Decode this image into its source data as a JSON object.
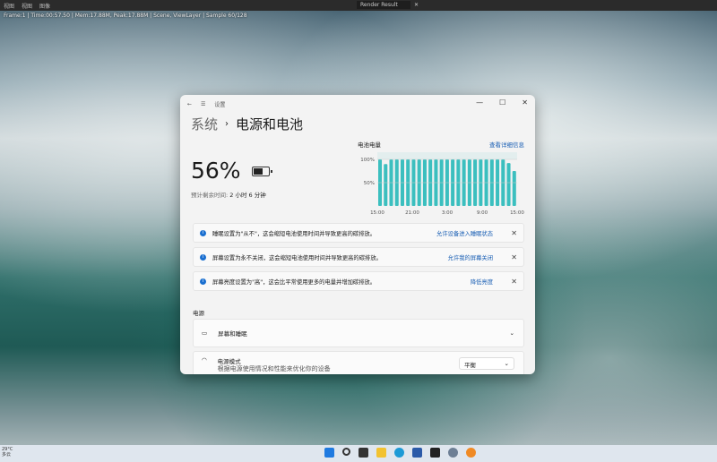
{
  "blender": {
    "menu": [
      "视图",
      "视图",
      "图像"
    ],
    "status": "Frame:1 | Time:00:57.50 | Mem:17.88M, Peak:17.88M | Scene, ViewLayer | Sample 60/128",
    "image_name": "Render Result"
  },
  "settings": {
    "window_title": "设置",
    "breadcrumb_parent": "系统",
    "breadcrumb_current": "电源和电池",
    "battery_percent": "56%",
    "battery_level": 56,
    "remaining_label": "预计剩余时间:",
    "remaining_value": "2 小时 6 分钟",
    "notices": [
      {
        "text": "睡眠设置为\"从不\"，这会缩短电池使用时间并导致更高的碳排放。",
        "action": "允许设备进入睡眠状态"
      },
      {
        "text": "屏幕设置为永不关闭，这会缩短电池使用时间并导致更高的碳排放。",
        "action": "允许我的屏幕关闭"
      },
      {
        "text": "屏幕亮度设置为\"高\"，这会比平常使用更多的电量并增加碳排放。",
        "action": "降低亮度"
      }
    ],
    "section_power": "电源",
    "screen_sleep": "屏幕和睡眠",
    "power_mode": "电源模式",
    "power_mode_desc": "根据电源使用情况和性能来优化你的设备",
    "power_mode_value": "平衡"
  },
  "chart_data": {
    "type": "bar",
    "title": "电池电量",
    "link": "查看详细信息",
    "yticks": [
      "100%",
      "50%"
    ],
    "xticks": [
      "15:00",
      "21:00",
      "3:00",
      "9:00",
      "15:00"
    ],
    "ylim": [
      0,
      100
    ],
    "values": [
      100,
      90,
      100,
      100,
      100,
      100,
      100,
      100,
      100,
      100,
      100,
      100,
      100,
      100,
      100,
      100,
      100,
      100,
      100,
      100,
      100,
      100,
      100,
      92,
      75
    ],
    "color": "#3bbfbf"
  },
  "taskbar": {
    "temp": "29°C",
    "weather": "多云"
  }
}
